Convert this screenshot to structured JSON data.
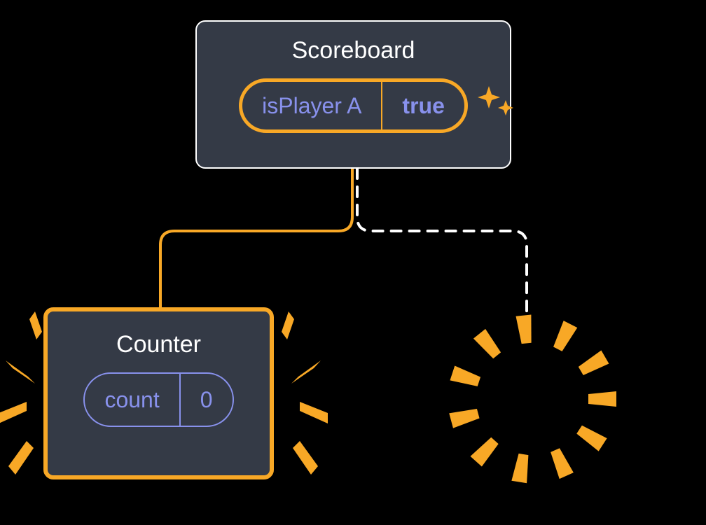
{
  "scoreboard": {
    "title": "Scoreboard",
    "state_key": "isPlayer A",
    "state_value": "true"
  },
  "counter": {
    "title": "Counter",
    "state_key": "count",
    "state_value": "0"
  },
  "colors": {
    "accent": "#f8a826",
    "node_bg": "#343a46",
    "text_state": "#8891ec"
  }
}
